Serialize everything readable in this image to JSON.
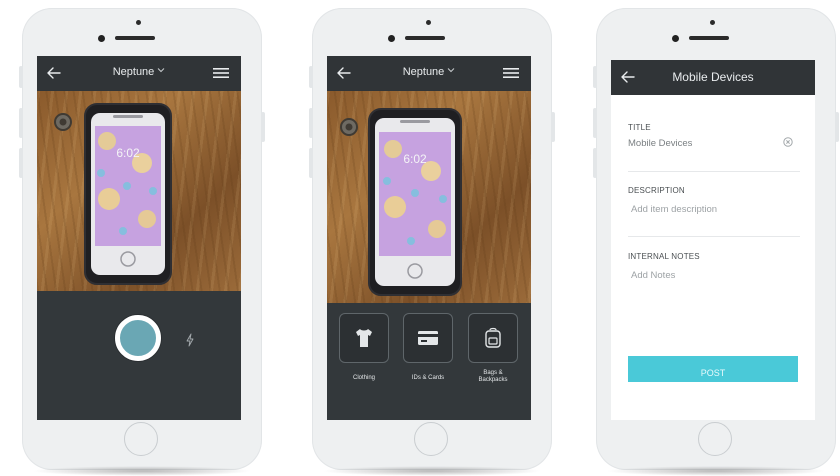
{
  "screens": [
    {
      "nav": {
        "title": "Neptune"
      },
      "camera": {
        "shutter": "shutter-button",
        "flash": "flash-icon"
      },
      "photo": {
        "clock": "6:02"
      }
    },
    {
      "nav": {
        "title": "Neptune"
      },
      "photo": {
        "clock": "6:02"
      },
      "categories": [
        {
          "label": "Clothing",
          "icon": "tshirt-icon"
        },
        {
          "label": "IDs & Cards",
          "icon": "card-icon"
        },
        {
          "label": "Bags & Backpacks",
          "icon": "backpack-icon"
        }
      ]
    },
    {
      "nav": {
        "title": "Mobile Devices"
      },
      "form": {
        "title_label": "TITLE",
        "title_value": "Mobile Devices",
        "description_label": "DESCRIPTION",
        "description_placeholder": "Add item description",
        "notes_label": "INTERNAL NOTES",
        "notes_placeholder": "Add Notes",
        "post_label": "POST"
      }
    }
  ],
  "colors": {
    "navbar": "#303437",
    "accent": "#4ac9d8",
    "shutter": "#6aa7b4",
    "dark_panel": "#33383b"
  }
}
